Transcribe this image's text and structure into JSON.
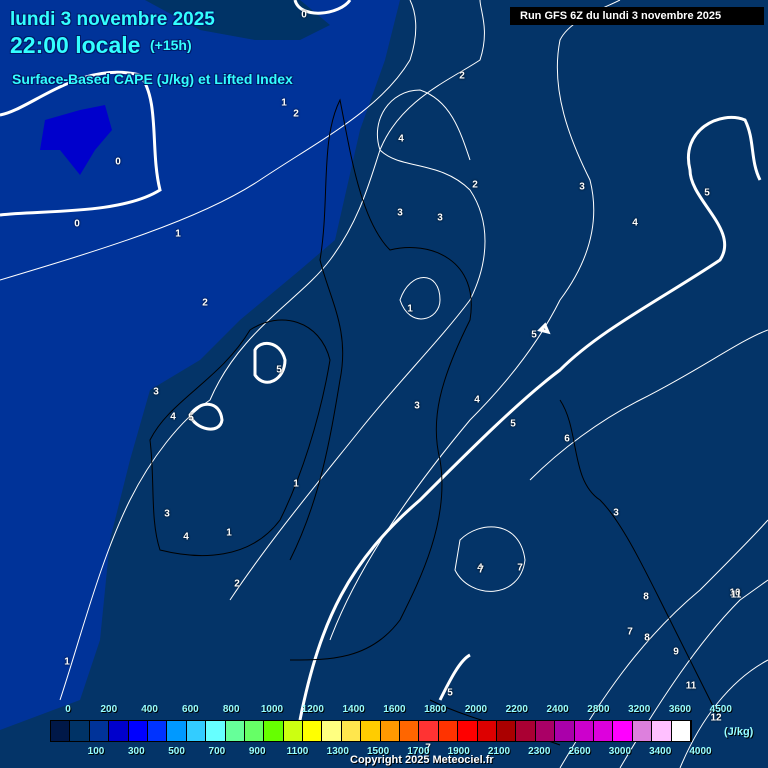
{
  "header": {
    "date": "lundi 3 novembre 2025",
    "time": "22:00 locale",
    "lead": "(+15h)",
    "parameter": "Surface-Based CAPE (J/kg) et Lifted Index",
    "run": "Run GFS 6Z du lundi 3 novembre 2025"
  },
  "colors": {
    "background": "#043468",
    "low_cape_region": "#003399",
    "cape_100_region": "#0022aa"
  },
  "contour_labels": [
    "0",
    "2",
    "2",
    "1",
    "0",
    "0",
    "1",
    "2",
    "4",
    "2",
    "3",
    "3",
    "3",
    "4",
    "1",
    "5",
    "5",
    "3",
    "4",
    "5",
    "3",
    "4",
    "1",
    "3",
    "4",
    "1",
    "2",
    "5",
    "6",
    "3",
    "4",
    "5",
    "7",
    "8",
    "7",
    "7",
    "8",
    "9",
    "10",
    "11",
    "11",
    "1",
    "5",
    "7",
    "12"
  ],
  "legend": {
    "colors": [
      "#001848",
      "#003366",
      "#003399",
      "#0000cc",
      "#0000ff",
      "#0033ff",
      "#0099ff",
      "#33ccff",
      "#66ffff",
      "#66ff99",
      "#66ff66",
      "#66ff00",
      "#ccff11",
      "#ffff00",
      "#ffff80",
      "#ffe64d",
      "#ffcc00",
      "#ff9900",
      "#ff6600",
      "#ff3333",
      "#ff3300",
      "#ff0000",
      "#dd0000",
      "#aa0000",
      "#aa0033",
      "#aa0066",
      "#aa00aa",
      "#cc00cc",
      "#dd00dd",
      "#ff00ff",
      "#dd80dd",
      "#ffc0ff",
      "#ffffff"
    ],
    "top_labels": [
      "0",
      "200",
      "400",
      "600",
      "800",
      "1000",
      "1200",
      "1400",
      "1600",
      "1800",
      "2000",
      "2200",
      "2400",
      "2800",
      "3200",
      "3600",
      "4500"
    ],
    "bottom_labels": [
      "100",
      "300",
      "500",
      "700",
      "900",
      "1100",
      "1300",
      "1500",
      "1700",
      "1900",
      "2100",
      "2300",
      "2600",
      "3000",
      "3400",
      "4000"
    ],
    "unit": "(J/kg)"
  },
  "copyright": "Copyright 2025 Meteociel.fr"
}
